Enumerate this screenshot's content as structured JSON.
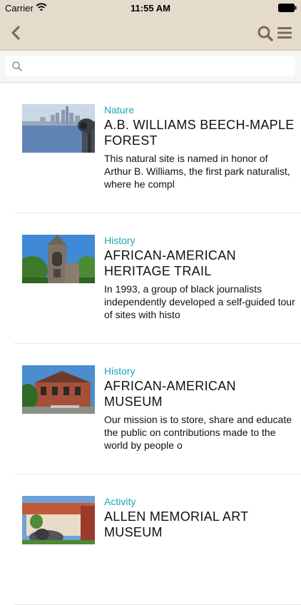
{
  "status_bar": {
    "carrier": "Carrier",
    "time": "11:55 AM"
  },
  "search": {
    "placeholder": "",
    "value": ""
  },
  "items": [
    {
      "category": "Nature",
      "title": "A.B. WILLIAMS BEECH-MAPLE FOREST",
      "description": "This natural site is named in honor of Arthur B. Williams, the first park naturalist, where he compl"
    },
    {
      "category": "History",
      "title": "AFRICAN-AMERICAN HERITAGE TRAIL",
      "description": "In 1993, a group of black journalists independently developed a self-guided tour of sites with histo"
    },
    {
      "category": "History",
      "title": "AFRICAN-AMERICAN MUSEUM",
      "description": "Our mission is to store, share and educate the public on contributions made to the world by people o"
    },
    {
      "category": "Activity",
      "title": "ALLEN MEMORIAL ART MUSEUM",
      "description": ""
    }
  ],
  "colors": {
    "nav_bg": "#e4dbcd",
    "category_accent": "#1fa7b3",
    "nav_icon": "#7a6a5c"
  },
  "icons": [
    "wifi-icon",
    "battery-icon",
    "back-chevron-icon",
    "search-icon",
    "menu-icon"
  ]
}
